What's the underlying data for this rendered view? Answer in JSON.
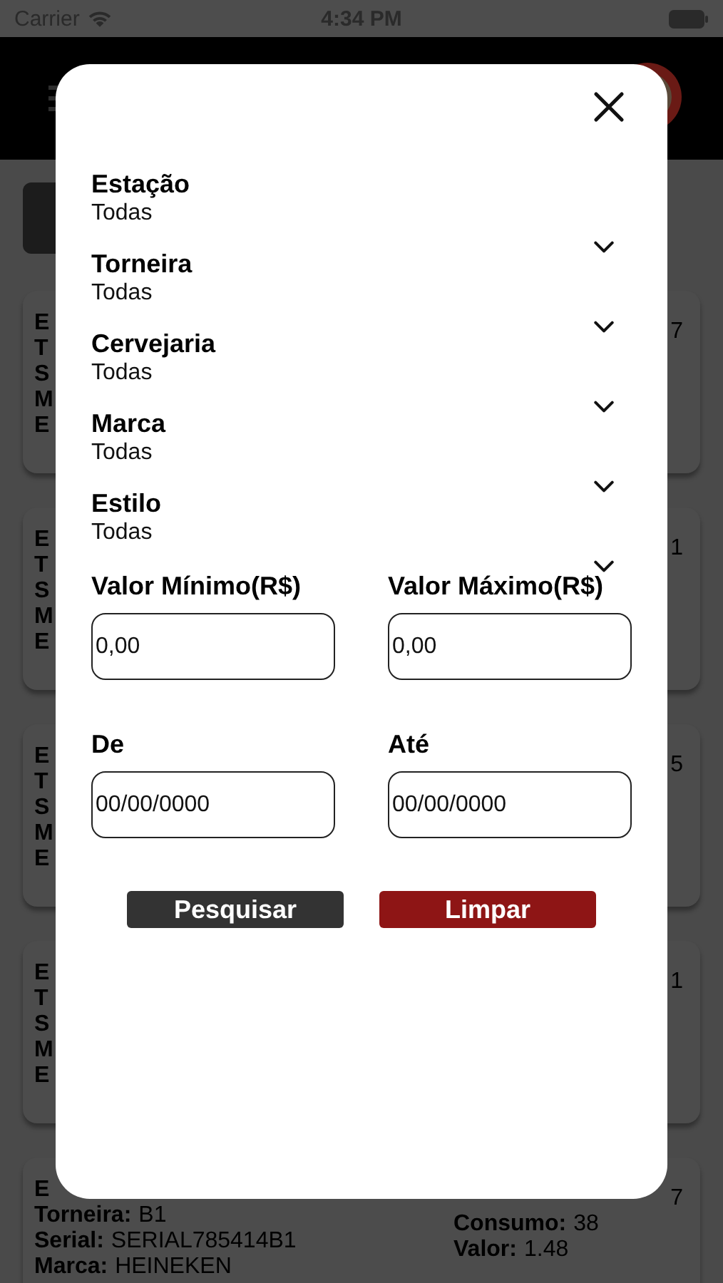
{
  "status_bar": {
    "carrier": "Carrier",
    "time": "4:34 PM"
  },
  "cards": [
    {
      "left": [
        {
          "label": "E"
        },
        {
          "label": "T"
        },
        {
          "label": "S"
        },
        {
          "label": "M"
        },
        {
          "label": "E"
        }
      ],
      "right": [
        {
          "value": "7"
        }
      ]
    },
    {
      "left": [
        {
          "label": "E"
        },
        {
          "label": "T"
        },
        {
          "label": "S"
        },
        {
          "label": "M"
        },
        {
          "label": "E"
        }
      ],
      "right": [
        {
          "value": "1"
        }
      ]
    },
    {
      "left": [
        {
          "label": "E"
        },
        {
          "label": "T"
        },
        {
          "label": "S"
        },
        {
          "label": "M"
        },
        {
          "label": "E"
        }
      ],
      "right": [
        {
          "value": "5"
        }
      ]
    },
    {
      "left": [
        {
          "label": "E"
        },
        {
          "label": "T"
        },
        {
          "label": "S"
        },
        {
          "label": "M"
        },
        {
          "label": "E"
        }
      ],
      "right": [
        {
          "value": "1"
        }
      ]
    },
    {
      "left": [
        {
          "label": "E"
        },
        {
          "label": "Torneira:",
          "value": "B1"
        },
        {
          "label": "Serial:",
          "value": "SERIAL785414B1"
        },
        {
          "label": "Marca:",
          "value": "HEINEKEN"
        }
      ],
      "right": [
        {
          "value": "7"
        },
        {
          "label": "Consumo:",
          "value": "38"
        },
        {
          "label": "Valor:",
          "value": "1.48"
        }
      ]
    }
  ],
  "filter_modal": {
    "dropdowns": [
      {
        "label": "Estação",
        "value": "Todas"
      },
      {
        "label": "Torneira",
        "value": "Todas"
      },
      {
        "label": "Cervejaria",
        "value": "Todas"
      },
      {
        "label": "Marca",
        "value": "Todas"
      },
      {
        "label": "Estilo",
        "value": "Todas"
      }
    ],
    "price_fields": [
      {
        "label": "Valor Mínimo(R$)",
        "value": "0,00"
      },
      {
        "label": "Valor Máximo(R$)",
        "value": "0,00"
      }
    ],
    "date_fields": [
      {
        "label": "De",
        "value": "00/00/0000"
      },
      {
        "label": "Até",
        "value": "00/00/0000"
      }
    ],
    "buttons": [
      {
        "label": "Pesquisar",
        "kind": "primary"
      },
      {
        "label": "Limpar",
        "kind": "danger"
      }
    ]
  }
}
